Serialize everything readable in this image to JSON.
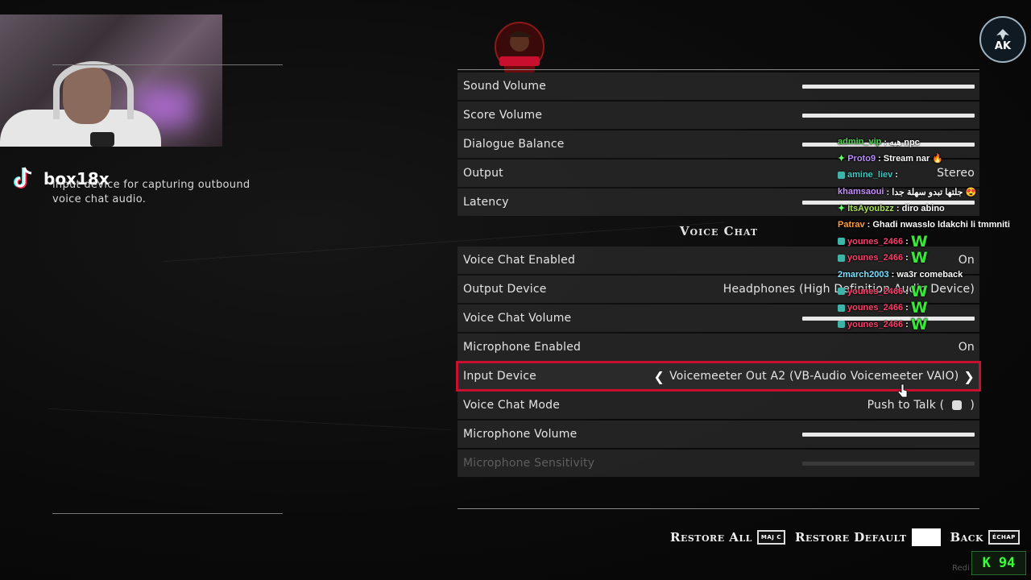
{
  "streamer": {
    "handle": "box18x"
  },
  "description": "input device for capturing outbound voice chat audio.",
  "settings": {
    "rows": [
      {
        "label": "Sound Volume",
        "kind": "slider"
      },
      {
        "label": "Score Volume",
        "kind": "slider"
      },
      {
        "label": "Dialogue Balance",
        "kind": "slider"
      },
      {
        "label": "Output",
        "kind": "value",
        "value": "Stereo"
      },
      {
        "label": "Latency",
        "kind": "slider"
      },
      {
        "label": "Voice Chat",
        "kind": "section"
      },
      {
        "label": "Voice Chat Enabled",
        "kind": "value",
        "value": "On"
      },
      {
        "label": "Output Device",
        "kind": "value",
        "value": "Headphones (High Definition Audio Device)"
      },
      {
        "label": "Voice Chat Volume",
        "kind": "slider"
      },
      {
        "label": "Microphone Enabled",
        "kind": "value",
        "value": "On"
      },
      {
        "label": "Input Device",
        "kind": "selector",
        "value": "Voicemeeter Out A2 (VB-Audio Voicemeeter VAIO)",
        "selected": true
      },
      {
        "label": "Voice Chat Mode",
        "kind": "value",
        "value": "Push to Talk (",
        "value_suffix": ")"
      },
      {
        "label": "Microphone Volume",
        "kind": "slider"
      },
      {
        "label": "Microphone Sensitivity",
        "kind": "slider",
        "disabled": true
      }
    ]
  },
  "chat": [
    {
      "user": "admin_vip",
      "color": "#4fd14f",
      "msg": ": هيه npc",
      "badge": "none"
    },
    {
      "user": "Proto9",
      "color": "#b98cff",
      "msg": ": Stream nar 🔥",
      "badge": "spark"
    },
    {
      "user": "amine_liev",
      "color": "#3fc9c0",
      "msg": ":",
      "badge": "square"
    },
    {
      "user": "khamsaoui",
      "color": "#c78cff",
      "msg": ": جلتها تبدو سهلة جدا 😍",
      "badge": "none"
    },
    {
      "user": "ItsAyoubzz",
      "color": "#a8e05a",
      "msg": ": diro abino",
      "badge": "spark"
    },
    {
      "user": "Patrav",
      "color": "#ff9a3c",
      "msg": ": Ghadi nwasslo ldakchi li tmmniti",
      "badge": "none"
    },
    {
      "user": "younes_2466",
      "color": "#ff3c6a",
      "msg": ":",
      "big": "W",
      "badge": "square"
    },
    {
      "user": "younes_2466",
      "color": "#ff3c6a",
      "msg": ":",
      "big": "W",
      "badge": "square"
    },
    {
      "user": "2march2003",
      "color": "#7ee0ff",
      "msg": ": wa3r comeback",
      "badge": "none"
    },
    {
      "user": "younes_2466",
      "color": "#ff3c6a",
      "msg": ":",
      "big": "W",
      "badge": "square"
    },
    {
      "user": "younes_2466",
      "color": "#ff3c6a",
      "msg": ":",
      "big": "W",
      "badge": "square"
    },
    {
      "user": "younes_2466",
      "color": "#ff3c6a",
      "msg": ":",
      "big": "W",
      "badge": "square"
    }
  ],
  "footer": {
    "restore_all": "Restore All",
    "restore_all_key": "MAJ C",
    "restore_default": "Restore Default",
    "back": "Back",
    "back_key": "ÉCHAP"
  },
  "overlay": {
    "fps_letter": "K",
    "fps_value": "94",
    "watermark": "Redi",
    "ak_logo": "AK"
  },
  "colors": {
    "selection": "#c8102e",
    "panel_row": "#282828",
    "accent_green": "#39e639"
  }
}
